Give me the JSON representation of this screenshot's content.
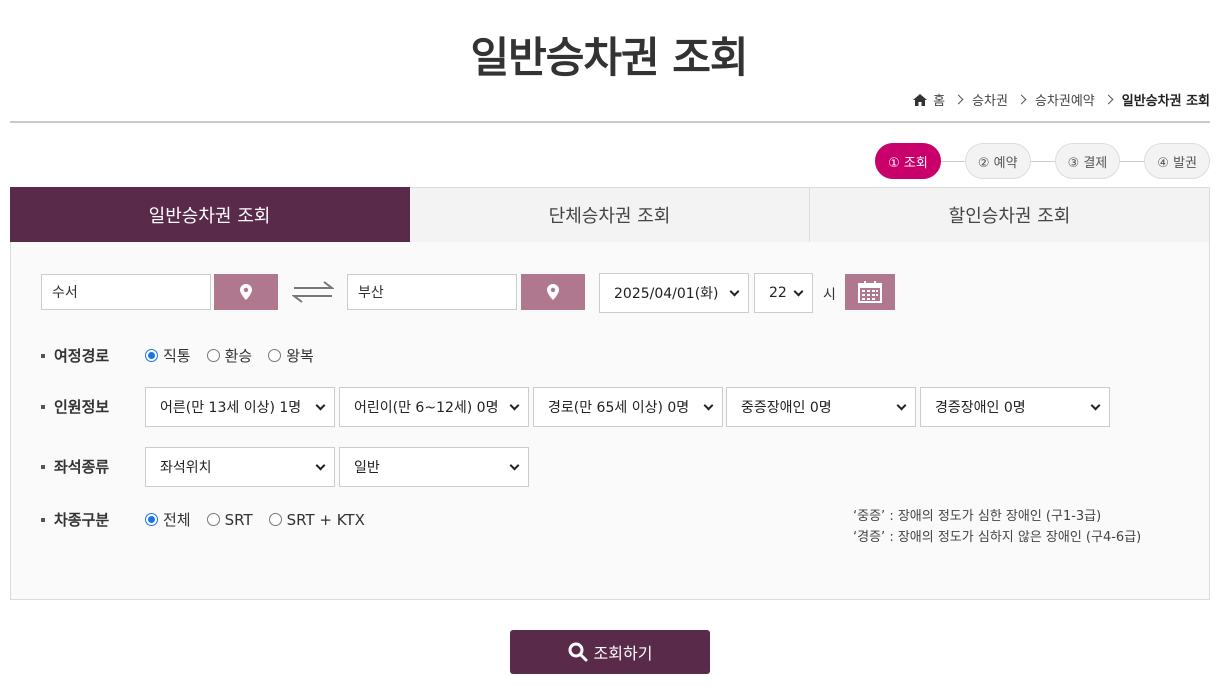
{
  "title": "일반승차권 조회",
  "breadcrumb": {
    "home": "홈",
    "items": [
      "승차권",
      "승차권예약"
    ],
    "current": "일반승차권 조회"
  },
  "steps": [
    "① 조회",
    "② 예약",
    "③ 결제",
    "④ 발권"
  ],
  "tabs": [
    "일반승차권 조회",
    "단체승차권 조회",
    "할인승차권 조회"
  ],
  "search": {
    "departure": "수서",
    "arrival": "부산",
    "date": "2025/04/01(화)",
    "hour": "22",
    "hour_unit": "시"
  },
  "route": {
    "label": "여정경로",
    "options": [
      "직통",
      "환승",
      "왕복"
    ],
    "selected": "직통"
  },
  "passengers": {
    "label": "인원정보",
    "selects": [
      "어른(만 13세 이상) 1명",
      "어린이(만 6~12세) 0명",
      "경로(만 65세 이상) 0명",
      "중증장애인 0명",
      "경증장애인 0명"
    ]
  },
  "seat": {
    "label": "좌석종류",
    "selects": [
      "좌석위치",
      "일반"
    ]
  },
  "train_type": {
    "label": "차종구분",
    "options": [
      "전체",
      "SRT",
      "SRT + KTX"
    ],
    "selected": "전체"
  },
  "notes": [
    "‘중증’ : 장애의 정도가 심한 장애인 (구1-3급)",
    "‘경증’ : 장애의 정도가 심하지 않은 장애인 (구4-6급)"
  ],
  "submit_label": "조회하기",
  "colors": {
    "accent": "#5a2a4a",
    "active_step": "#c9006b",
    "pin_button": "#b0788f"
  }
}
